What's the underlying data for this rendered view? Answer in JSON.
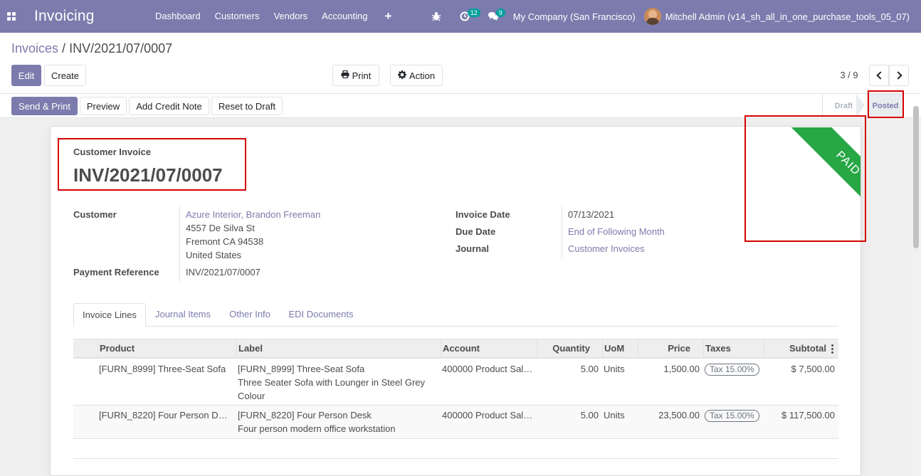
{
  "navbar": {
    "app_title": "Invoicing",
    "menu": [
      "Dashboard",
      "Customers",
      "Vendors",
      "Accounting"
    ],
    "plus_label": "+",
    "activity_count": "12",
    "message_count": "9",
    "company": "My Company (San Francisco)",
    "user": "Mitchell Admin (v14_sh_all_in_one_purchase_tools_05_07)"
  },
  "breadcrumb": {
    "parent": "Invoices",
    "separator": " / ",
    "current": "INV/2021/07/0007"
  },
  "control": {
    "edit_label": "Edit",
    "create_label": "Create",
    "print_label": "Print",
    "action_label": "Action",
    "pager": "3 / 9"
  },
  "statusbar": {
    "buttons": [
      "Send & Print",
      "Preview",
      "Add Credit Note",
      "Reset to Draft"
    ],
    "stages": [
      "Draft",
      "Posted"
    ],
    "active_stage": "Posted"
  },
  "invoice": {
    "type_label": "Customer Invoice",
    "number": "INV/2021/07/0007",
    "ribbon": "PAID",
    "ribbon_color": "#28a745",
    "customer_label": "Customer",
    "customer_name": "Azure Interior, Brandon Freeman",
    "address": [
      "4557 De Silva St",
      "Fremont CA 94538",
      "United States"
    ],
    "payment_ref_label": "Payment Reference",
    "payment_ref": "INV/2021/07/0007",
    "invoice_date_label": "Invoice Date",
    "invoice_date": "07/13/2021",
    "due_date_label": "Due Date",
    "due_date": "End of Following Month",
    "journal_label": "Journal",
    "journal": "Customer Invoices"
  },
  "tabs": [
    "Invoice Lines",
    "Journal Items",
    "Other Info",
    "EDI Documents"
  ],
  "table": {
    "columns": [
      "Product",
      "Label",
      "Account",
      "Quantity",
      "UoM",
      "Price",
      "Taxes",
      "Subtotal"
    ],
    "rows": [
      {
        "product": "[FURN_8999] Three-Seat Sofa",
        "label": [
          "[FURN_8999] Three-Seat Sofa",
          "Three Seater Sofa with Lounger in Steel Grey",
          "Colour"
        ],
        "account": "400000 Product Sal…",
        "quantity": "5.00",
        "uom": "Units",
        "price": "1,500.00",
        "tax": "Tax 15.00%",
        "subtotal": "$ 7,500.00"
      },
      {
        "product": "[FURN_8220] Four Person D…",
        "label": [
          "[FURN_8220] Four Person Desk",
          "Four person modern office workstation"
        ],
        "account": "400000 Product Sal…",
        "quantity": "5.00",
        "uom": "Units",
        "price": "23,500.00",
        "tax": "Tax 15.00%",
        "subtotal": "$ 117,500.00"
      }
    ]
  },
  "colors": {
    "brand": "#7c7bad",
    "highlight": "#d70000",
    "paid": "#28a745"
  }
}
